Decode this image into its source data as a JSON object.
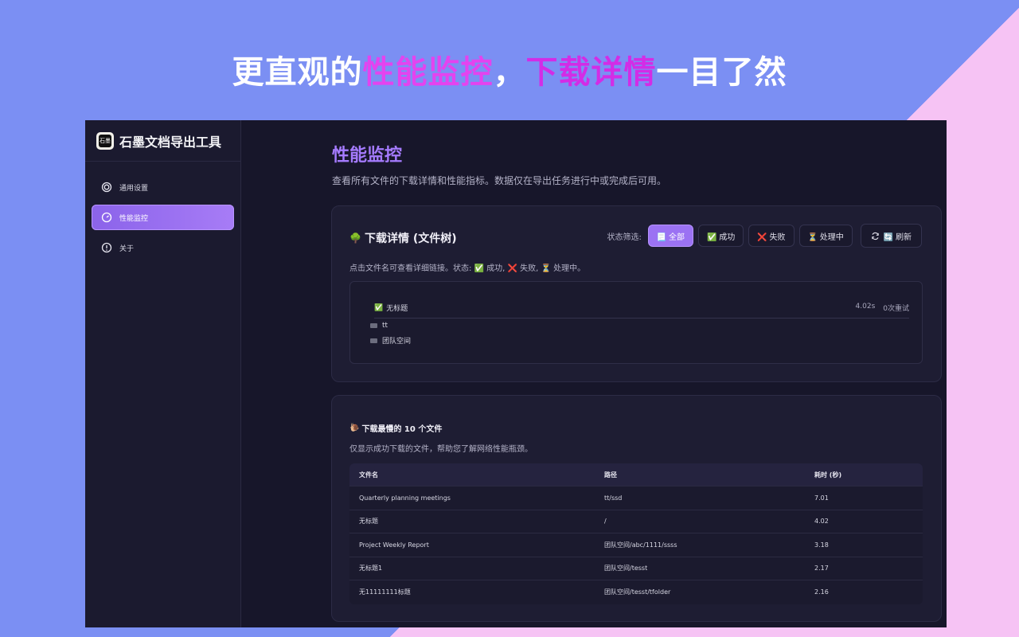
{
  "headline": {
    "part1": "更直观的",
    "highlight1": "性能监控",
    "part2": "，",
    "highlight2": "下载详情",
    "part3": "一目了然"
  },
  "app": {
    "logo_text": "石墨",
    "title": "石墨文档导出工具"
  },
  "sidebar": {
    "items": [
      {
        "label": "通用设置",
        "icon": "settings-icon",
        "active": false
      },
      {
        "label": "性能监控",
        "icon": "gauge-icon",
        "active": true
      },
      {
        "label": "关于",
        "icon": "info-icon",
        "active": false
      }
    ]
  },
  "page": {
    "title": "性能监控",
    "description": "查看所有文件的下载详情和性能指标。数据仅在导出任务进行中或完成后可用。"
  },
  "details_card": {
    "icon": "🌳",
    "title": "下载详情 (文件树)",
    "filter_label": "状态筛选:",
    "filters": [
      {
        "label": "📃 全部",
        "active": true
      },
      {
        "label": "✅ 成功",
        "active": false
      },
      {
        "label": "❌ 失败",
        "active": false
      },
      {
        "label": "⏳ 处理中",
        "active": false
      }
    ],
    "refresh_label": "🔄 刷新",
    "hint": "点击文件名可查看详细链接。状态: ✅ 成功, ❌ 失败, ⏳ 处理中。",
    "tree": {
      "file": {
        "status": "✅",
        "name": "无标题",
        "time": "4.02s",
        "retries": "0次重试"
      },
      "folders": [
        "tt",
        "团队空间"
      ]
    }
  },
  "slowest_card": {
    "icon": "🐌",
    "title": "下载最慢的 10 个文件",
    "description": "仅显示成功下载的文件，帮助您了解网络性能瓶颈。",
    "columns": [
      "文件名",
      "路径",
      "耗时 (秒)"
    ],
    "rows": [
      [
        "Quarterly planning meetings",
        "tt/ssd",
        "7.01"
      ],
      [
        "无标题",
        "/",
        "4.02"
      ],
      [
        "Project Weekly Report",
        "团队空间/abc/1111/ssss",
        "3.18"
      ],
      [
        "无标题1",
        "团队空间/tesst",
        "2.17"
      ],
      [
        "无11111111标题",
        "团队空间/tesst/tfolder",
        "2.16"
      ]
    ]
  },
  "colors": {
    "accent": "#9b72f3",
    "title_purple": "#a57bff",
    "headline_pink": "#e443ef",
    "background_blue": "#7b8ff3",
    "background_pink": "#f6c3f4"
  }
}
